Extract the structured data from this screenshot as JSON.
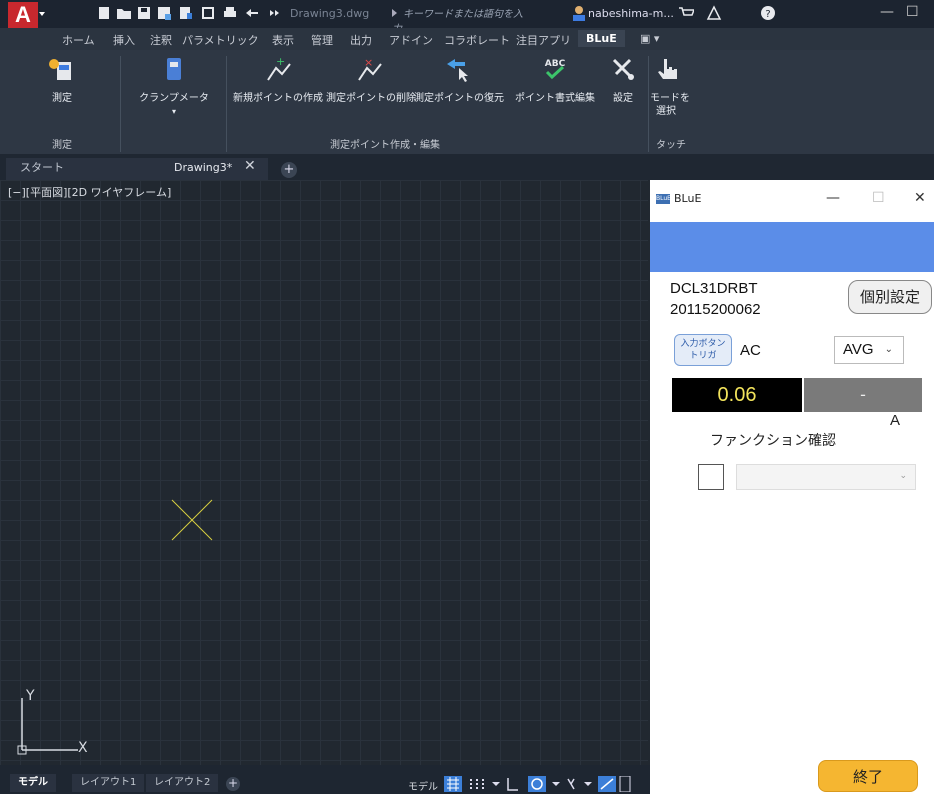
{
  "app": {
    "logo_letter": "A",
    "document_title": "Drawing3.dwg",
    "search_placeholder": "キーワードまたは語句を入力",
    "user_name": "nabeshima-m...",
    "accent_color": "#c8282e"
  },
  "ribbon_tabs": [
    "ホーム",
    "挿入",
    "注釈",
    "パラメトリック",
    "表示",
    "管理",
    "出力",
    "アドイン",
    "コラボレート",
    "注目アプリ",
    "BLuE"
  ],
  "active_tab": "BLuE",
  "ribbon": {
    "buttons": [
      {
        "label": "測定",
        "icon": "measure-icon"
      },
      {
        "label": "クランプメータ",
        "icon": "clamp-meter-icon"
      },
      {
        "label": "新規ポイントの作成",
        "icon": "new-point-icon"
      },
      {
        "label": "測定ポイントの削除",
        "icon": "delete-point-icon"
      },
      {
        "label": "測定ポイントの復元",
        "icon": "restore-point-icon"
      },
      {
        "label": "ポイント書式編集",
        "icon": "format-edit-icon"
      },
      {
        "label": "設定",
        "icon": "settings-icon"
      },
      {
        "label": "モードを選択",
        "label_line1": "モードを",
        "label_line2": "選択",
        "icon": "touch-icon"
      }
    ],
    "panel_labels": {
      "measure": "測定",
      "point_edit": "測定ポイント作成・編集",
      "touch": "タッチ"
    }
  },
  "file_tabs": {
    "start": "スタート",
    "current": "Drawing3*"
  },
  "viewport": {
    "label": "[−][平面図][2D ワイヤフレーム]",
    "ucs_x": "X",
    "ucs_y": "Y"
  },
  "status_bar": {
    "tabs": [
      "モデル",
      "レイアウト1",
      "レイアウト2"
    ],
    "model_label": "モデル"
  },
  "dialog": {
    "title": "BLuE",
    "title_icon": "BLuE",
    "device_model": "DCL31DRBT",
    "device_serial": "20115200062",
    "individual_settings_button": "個別設定",
    "input_trigger_line1": "入力ボタン",
    "input_trigger_line2": "トリガ",
    "mode": "AC",
    "avg_option": "AVG",
    "value_primary": "0.06",
    "value_secondary": "-",
    "unit": "A",
    "function_check_label": "ファンクション確認",
    "end_button": "終了",
    "banner_color": "#5b8de8",
    "end_button_color": "#f5b631"
  }
}
